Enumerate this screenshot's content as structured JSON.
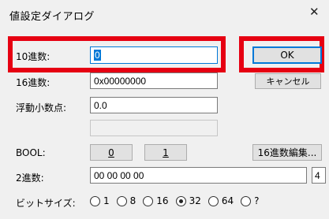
{
  "window": {
    "title": "値設定ダイアログ",
    "close_glyph": "✕"
  },
  "fields": {
    "dec_label": "10進数:",
    "dec_value": "0",
    "hex_label": "16進数:",
    "hex_value": "0x00000000",
    "float_label": "浮動小数点:",
    "float_value": "0.0",
    "extra_value": "",
    "bool_label": "BOOL:",
    "bool_false": "0",
    "bool_true": "1",
    "bin_label": "2進数:",
    "bin_value": "00 00 00 00",
    "bin_count": "4",
    "bitsize_label": "ビットサイズ:"
  },
  "buttons": {
    "ok": "OK",
    "cancel": "キャンセル",
    "hex_edit": "16進数編集..."
  },
  "bitsizes": {
    "options": [
      "1",
      "8",
      "16",
      "32",
      "64",
      "?"
    ],
    "selected": "32"
  },
  "colors": {
    "highlight": "#e60012",
    "focus": "#0078d7"
  }
}
